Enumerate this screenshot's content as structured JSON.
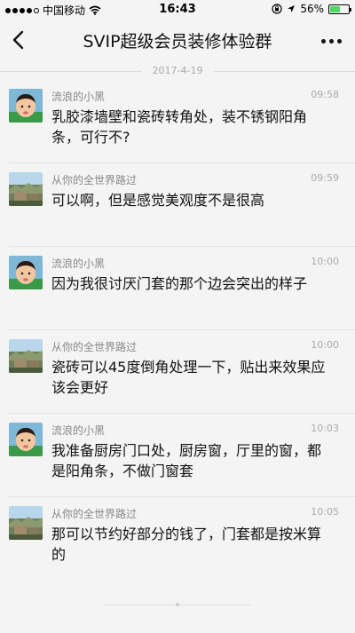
{
  "status_bar": {
    "carrier": "中国移动",
    "time": "16:43",
    "battery_percent": "56%",
    "battery_level": 0.56,
    "battery_color": "#4cd964"
  },
  "nav": {
    "back_icon": "chevron-left-icon",
    "title": "SVIP超级会员装修体验群",
    "more_icon": "more-dots-icon"
  },
  "date_divider": "2017-4-19",
  "messages": [
    {
      "sender": "流浪的小黑",
      "time": "09:58",
      "text": "乳胶漆墙壁和瓷砖转角处，装不锈钢阳角条，可行不?",
      "avatar": "child-avatar"
    },
    {
      "sender": "从你的全世界路过",
      "time": "09:59",
      "text": "可以啊，但是感觉美观度不是很高",
      "avatar": "landscape-avatar"
    },
    {
      "sender": "流浪的小黑",
      "time": "10:00",
      "text": "因为我很讨厌门套的那个边会突出的样子",
      "avatar": "child-avatar"
    },
    {
      "sender": "从你的全世界路过",
      "time": "10:00",
      "text": "瓷砖可以45度倒角处理一下，贴出来效果应该会更好",
      "avatar": "landscape-avatar"
    },
    {
      "sender": "流浪的小黑",
      "time": "10:03",
      "text": "我准备厨房门口处，厨房窗，厅里的窗，都是阳角条，不做门窗套",
      "avatar": "child-avatar"
    },
    {
      "sender": "从你的全世界路过",
      "time": "10:05",
      "text": "那可以节约好部分的钱了，门套都是按米算的",
      "avatar": "landscape-avatar"
    }
  ]
}
